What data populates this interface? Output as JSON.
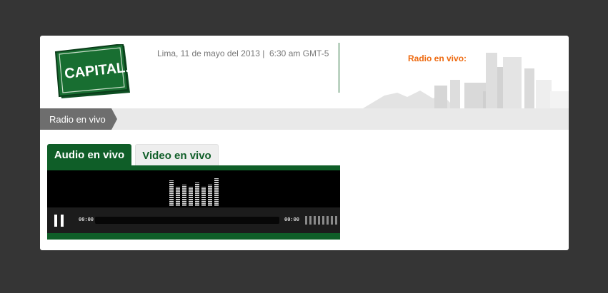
{
  "header": {
    "logo_text": "CAPITAL.PE",
    "date": "Lima, 11 de mayo del 2013 |",
    "time": "6:30 am GMT-5",
    "radio_live_label": "Radio en vivo:"
  },
  "breadcrumb": {
    "current": "Radio en vivo"
  },
  "tabs": [
    {
      "label": "Audio en vivo",
      "active": true
    },
    {
      "label": "Video en vivo",
      "active": false
    }
  ],
  "player": {
    "state_icon": "pause-icon",
    "elapsed": "00:00",
    "duration": "00:00",
    "progress": 0,
    "volume_segments": 8
  },
  "colors": {
    "brand_green": "#0f5e28",
    "accent_orange": "#ee6a10"
  }
}
